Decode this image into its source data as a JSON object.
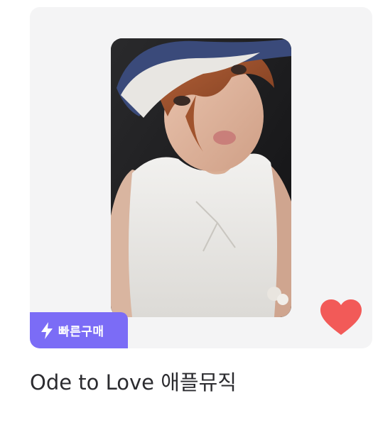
{
  "product": {
    "title": "Ode to Love 애플뮤직",
    "badge_label": "빠른구매",
    "badge_icon": "lightning-icon",
    "like_icon": "heart-icon",
    "accent_color": "#7b6cf6",
    "heart_color": "#f25a58"
  }
}
